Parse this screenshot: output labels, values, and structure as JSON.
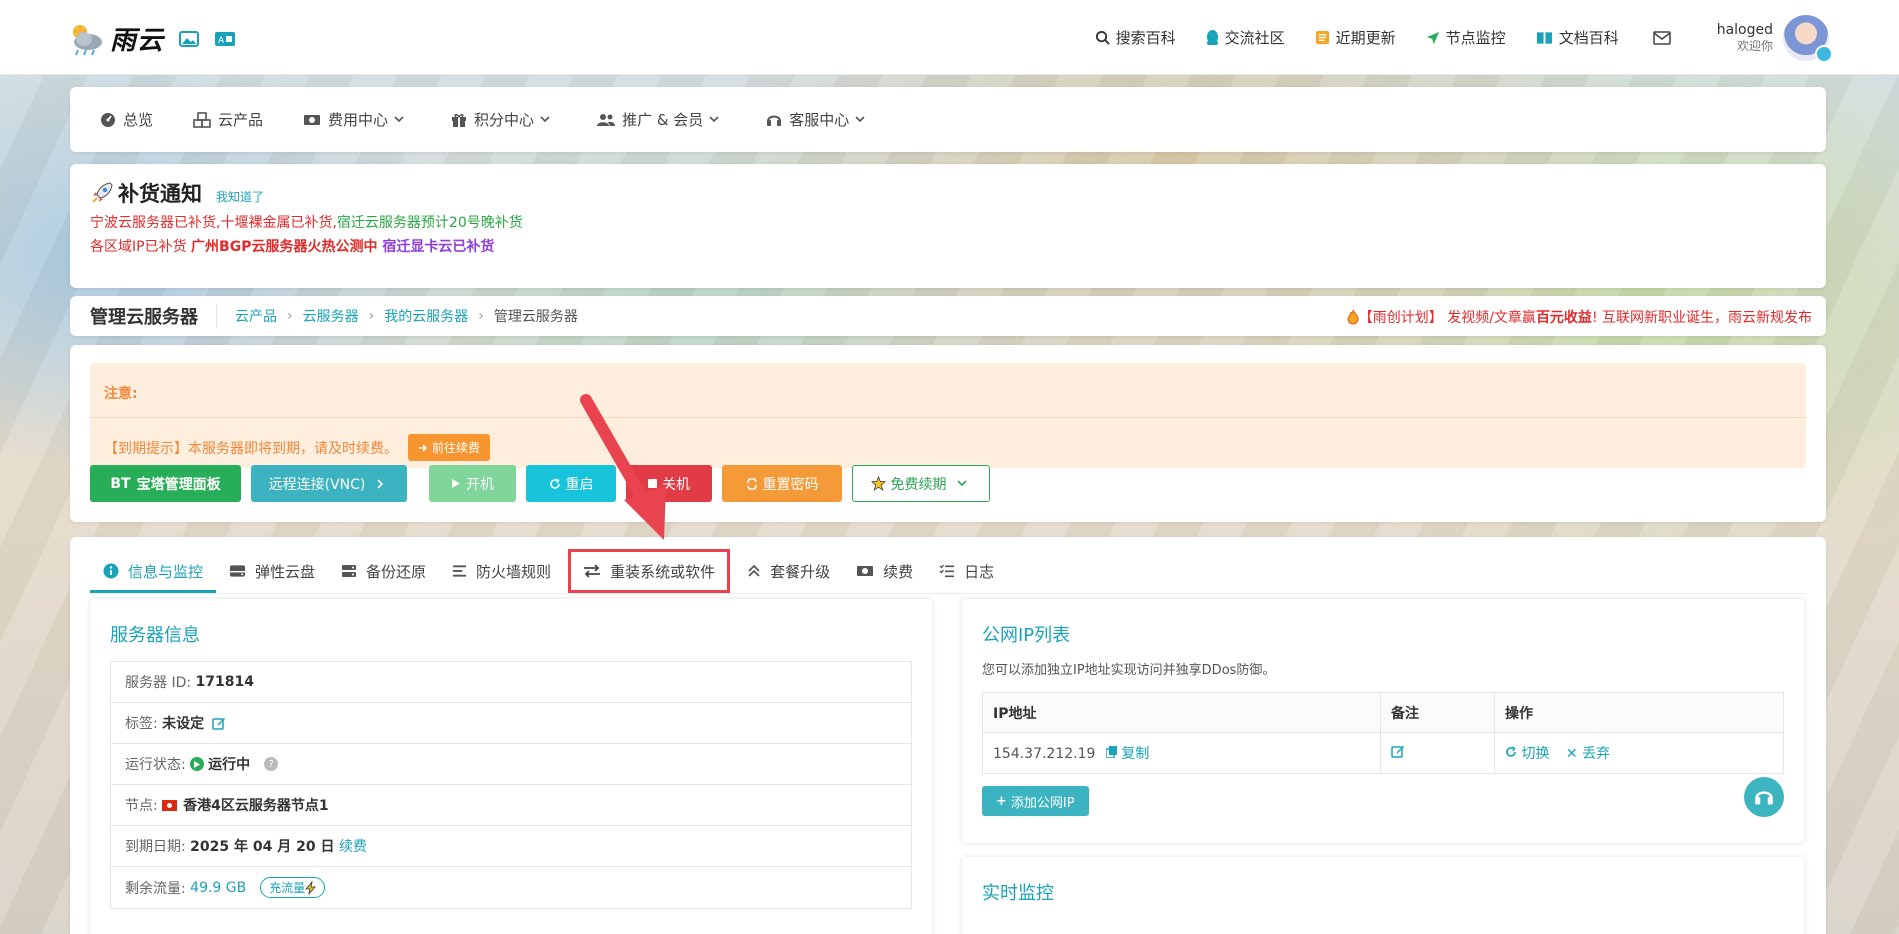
{
  "brand": {
    "name": "雨云"
  },
  "topnav": {
    "items": [
      {
        "label": "搜索百科"
      },
      {
        "label": "交流社区"
      },
      {
        "label": "近期更新"
      },
      {
        "label": "节点监控"
      },
      {
        "label": "文档百科"
      }
    ],
    "user": {
      "name": "haloged",
      "greeting": "欢迎你"
    }
  },
  "mainnav": {
    "items": [
      {
        "label": "总览"
      },
      {
        "label": "云产品"
      },
      {
        "label": "费用中心"
      },
      {
        "label": "积分中心"
      },
      {
        "label": "推广 & 会员"
      },
      {
        "label": "客服中心"
      }
    ]
  },
  "notice": {
    "title": "补货通知",
    "ack": "我知道了",
    "line1": {
      "a": "宁波云服务器已补货,十堰裸金属已补货,",
      "b": "宿迁云服务器预计20号晚补货"
    },
    "line2": {
      "a": "各区域IP已补货 ",
      "b": "广州BGP云服务器火热公测中 ",
      "c": "宿迁显卡云已补货"
    }
  },
  "crumbbar": {
    "title": "管理云服务器",
    "crumbs": [
      "云产品",
      "云服务器",
      "我的云服务器"
    ],
    "current": "管理云服务器",
    "promo": {
      "a": "【雨创计划】 发视频/文章赢",
      "b": "百元收益",
      "c": "! 互联网新职业诞生，雨云新规发布"
    }
  },
  "alert": {
    "head": "注意:",
    "body": "【到期提示】本服务器即将到期，请及时续费。",
    "button": "前往续费"
  },
  "actions": {
    "bt": "宝塔管理面板",
    "bt_prefix": "BT",
    "vnc": "远程连接(VNC)",
    "start": "开机",
    "restart": "重启",
    "shutdown": "关机",
    "reset_pwd": "重置密码",
    "free_renew": "免费续期"
  },
  "tabs": [
    {
      "label": "信息与监控"
    },
    {
      "label": "弹性云盘"
    },
    {
      "label": "备份还原"
    },
    {
      "label": "防火墙规则"
    },
    {
      "label": "重装系统或软件"
    },
    {
      "label": "套餐升级"
    },
    {
      "label": "续费"
    },
    {
      "label": "日志"
    }
  ],
  "server_info": {
    "title": "服务器信息",
    "rows": {
      "id": {
        "label": "服务器 ID:",
        "value": "171814"
      },
      "tag": {
        "label": "标签:",
        "value": "未设定"
      },
      "status": {
        "label": "运行状态:",
        "value": "运行中"
      },
      "node": {
        "label": "节点:",
        "value": "香港4区云服务器节点1"
      },
      "expire": {
        "label": "到期日期:",
        "value": "2025 年 04 月 20 日",
        "link": "续费"
      },
      "traffic": {
        "label": "剩余流量:",
        "value": "49.9 GB",
        "pill": "充流量"
      }
    }
  },
  "ip_list": {
    "title": "公网IP列表",
    "desc": "您可以添加独立IP地址实现访问并独享DDos防御。",
    "headers": [
      "IP地址",
      "备注",
      "操作"
    ],
    "row": {
      "ip": "154.37.212.19",
      "copy": "复制",
      "switch": "切换",
      "drop": "丢弃"
    },
    "add": "添加公网IP"
  },
  "monitor": {
    "title": "实时监控"
  },
  "colors": {
    "accent": "#1aa3b8",
    "highlight": "#e8434f",
    "success": "#28ad58",
    "danger": "#e13c45",
    "warning": "#f49a38"
  }
}
